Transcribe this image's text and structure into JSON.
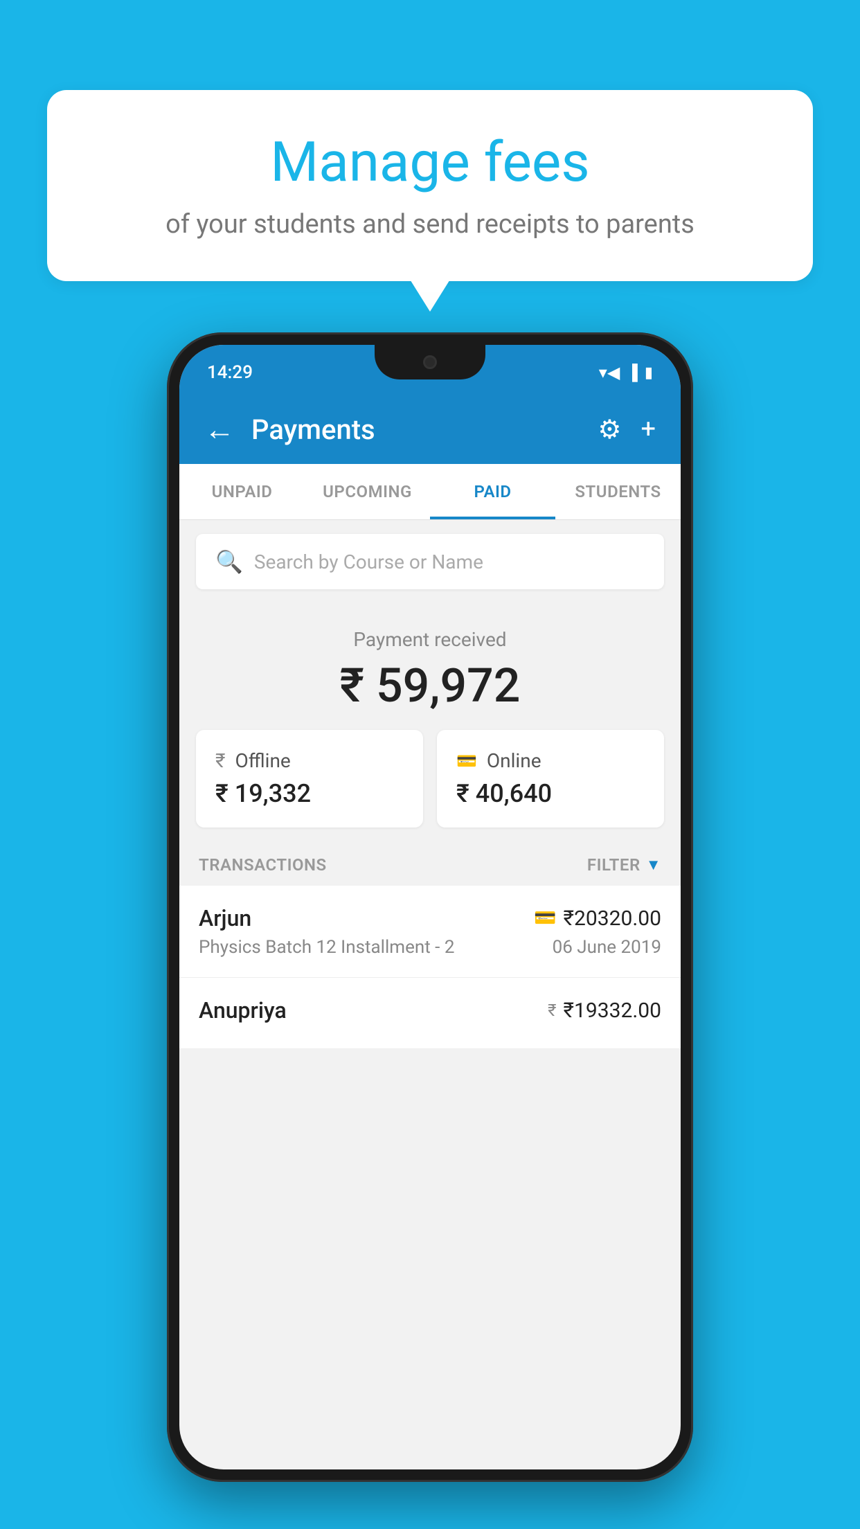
{
  "background": {
    "color": "#1ab5e8"
  },
  "speech_bubble": {
    "title": "Manage fees",
    "subtitle": "of your students and send receipts to parents"
  },
  "status_bar": {
    "time": "14:29"
  },
  "app_bar": {
    "title": "Payments",
    "back_label": "←",
    "gear_label": "⚙",
    "plus_label": "+"
  },
  "tabs": [
    {
      "id": "unpaid",
      "label": "UNPAID",
      "active": false
    },
    {
      "id": "upcoming",
      "label": "UPCOMING",
      "active": false
    },
    {
      "id": "paid",
      "label": "PAID",
      "active": true
    },
    {
      "id": "students",
      "label": "STUDENTS",
      "active": false
    }
  ],
  "search": {
    "placeholder": "Search by Course or Name"
  },
  "payment_summary": {
    "label": "Payment received",
    "amount": "₹ 59,972"
  },
  "payment_cards": [
    {
      "type": "Offline",
      "amount": "₹ 19,332",
      "icon": "₹"
    },
    {
      "type": "Online",
      "amount": "₹ 40,640",
      "icon": "💳"
    }
  ],
  "transactions_header": {
    "label": "TRANSACTIONS",
    "filter_label": "FILTER"
  },
  "transactions": [
    {
      "name": "Arjun",
      "course": "Physics Batch 12 Installment - 2",
      "amount": "₹20320.00",
      "date": "06 June 2019",
      "icon": "💳"
    },
    {
      "name": "Anupriya",
      "course": "",
      "amount": "₹19332.00",
      "date": "",
      "icon": "₹"
    }
  ]
}
